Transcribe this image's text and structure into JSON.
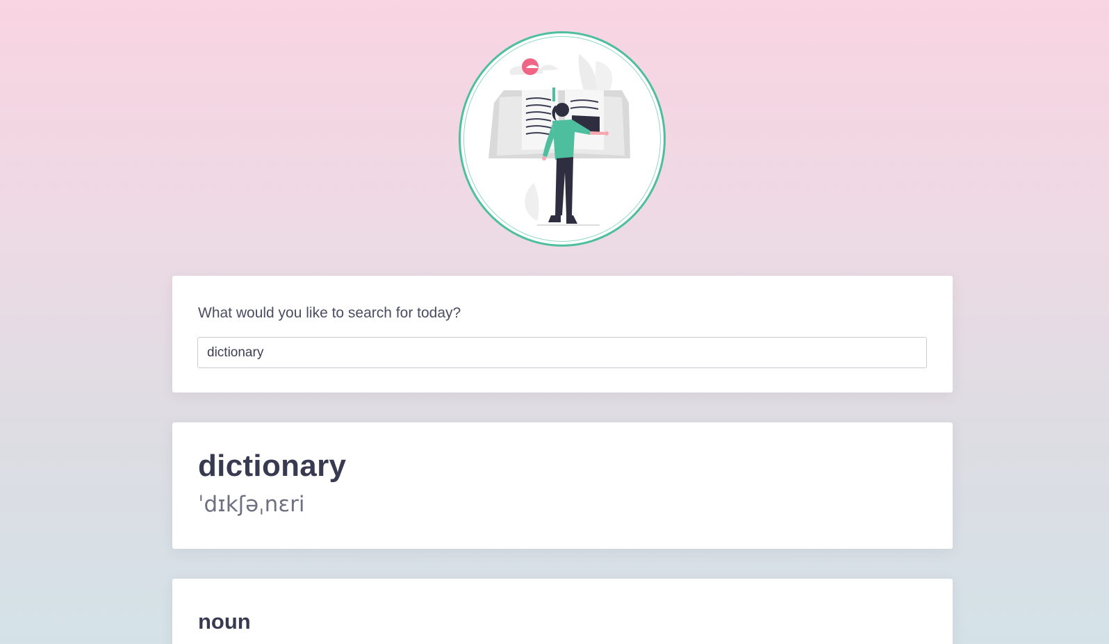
{
  "hero": {
    "illustration": "person-reading-open-book",
    "accent_color": "#4dbf9e",
    "highlight_color": "#f06585"
  },
  "search": {
    "prompt": "What would you like to search for today?",
    "value": "dictionary"
  },
  "result": {
    "word": "dictionary",
    "phonetic": "ˈdɪkʃəˌnɛri"
  },
  "meanings": [
    {
      "part_of_speech": "noun"
    }
  ]
}
